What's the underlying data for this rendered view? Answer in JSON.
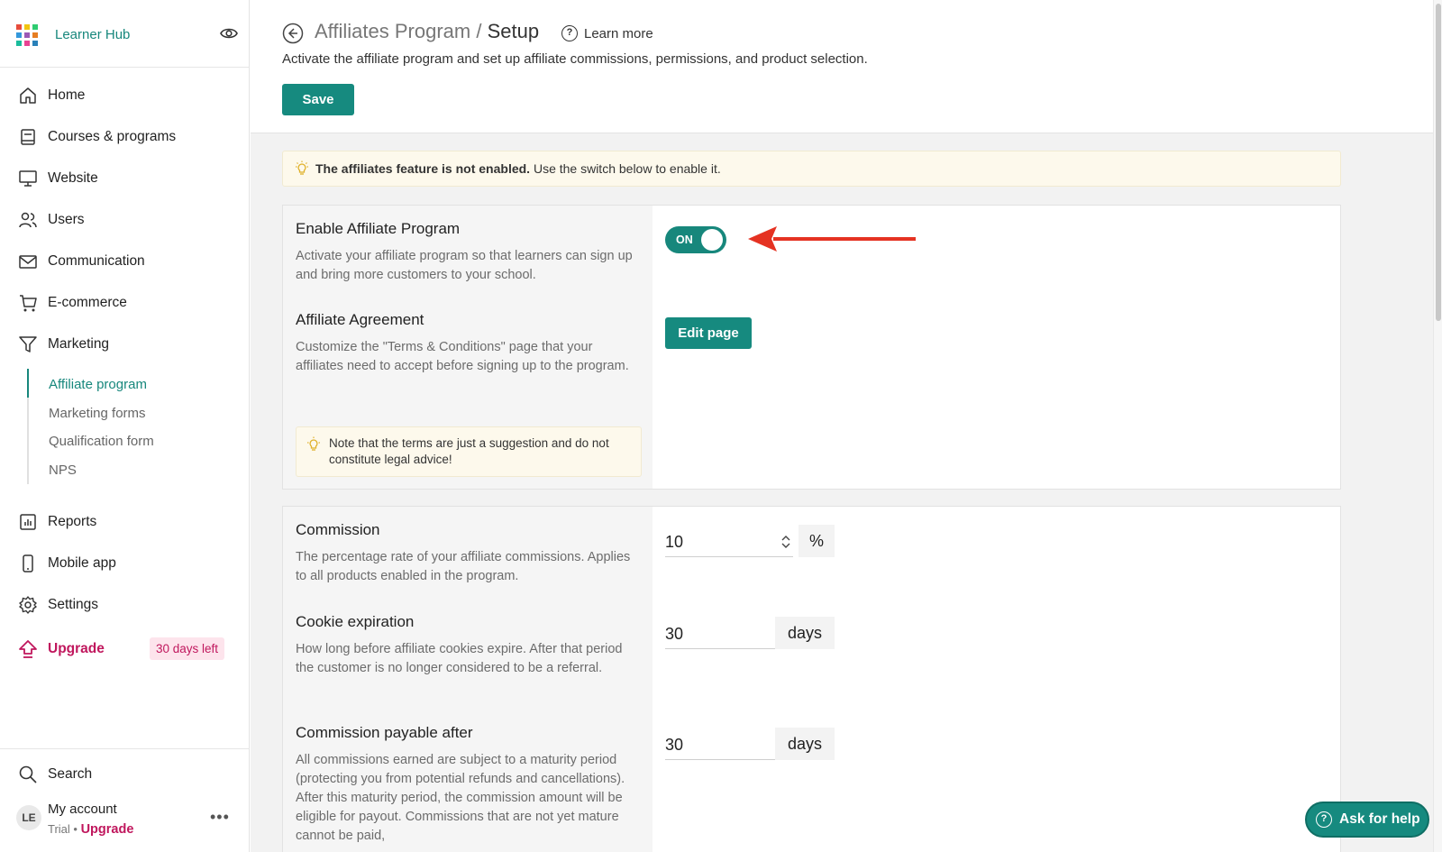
{
  "brand": {
    "name": "Learner Hub",
    "logo_colors": [
      "#e74c3c",
      "#f1c40f",
      "#2ecc71",
      "#3498db",
      "#9b59b6",
      "#e67e22",
      "#1abc9c",
      "#e84393",
      "#2980b9"
    ]
  },
  "sidebar": {
    "items": [
      {
        "label": "Home",
        "icon": "home-icon"
      },
      {
        "label": "Courses & programs",
        "icon": "book-icon"
      },
      {
        "label": "Website",
        "icon": "monitor-icon"
      },
      {
        "label": "Users",
        "icon": "users-icon"
      },
      {
        "label": "Communication",
        "icon": "mail-icon"
      },
      {
        "label": "E-commerce",
        "icon": "cart-icon"
      },
      {
        "label": "Marketing",
        "icon": "funnel-icon"
      }
    ],
    "marketing_sub": [
      "Affiliate program",
      "Marketing forms",
      "Qualification form",
      "NPS"
    ],
    "items_after": [
      {
        "label": "Reports",
        "icon": "chart-icon"
      },
      {
        "label": "Mobile app",
        "icon": "phone-icon"
      },
      {
        "label": "Settings",
        "icon": "gear-icon"
      }
    ],
    "upgrade": {
      "label": "Upgrade",
      "badge": "30 days left"
    },
    "search_label": "Search",
    "account": {
      "initials": "LE",
      "name": "My account",
      "plan": "Trial",
      "separator": " • ",
      "upgrade": "Upgrade"
    }
  },
  "header": {
    "title_prefix": "Affiliates Program / ",
    "title_current": "Setup",
    "learn_more": "Learn more",
    "subtitle": "Activate the affiliate program and set up affiliate commissions, permissions, and product selection.",
    "save_label": "Save"
  },
  "alert": {
    "bold": "The affiliates feature is not enabled.",
    "rest": " Use the switch below to enable it."
  },
  "enable": {
    "title": "Enable Affiliate Program",
    "desc": "Activate your affiliate program so that learners can sign up and bring more customers to your school.",
    "toggle_label": "ON"
  },
  "agreement": {
    "title": "Affiliate Agreement",
    "desc": "Customize the \"Terms & Conditions\" page that your affiliates need to accept before signing up to the program.",
    "button": "Edit page",
    "note": "Note that the terms are just a suggestion and do not constitute legal advice!"
  },
  "commission": {
    "title": "Commission",
    "desc": "The percentage rate of your affiliate commissions. Applies to all products enabled in the program.",
    "value": "10",
    "unit": "%"
  },
  "cookie": {
    "title": "Cookie expiration",
    "desc": "How long before affiliate cookies expire. After that period the customer is no longer considered to be a referral.",
    "value": "30",
    "unit": "days"
  },
  "payable": {
    "title": "Commission payable after",
    "desc": "All commissions earned are subject to a maturity period (protecting you from potential refunds and cancellations). After this maturity period, the commission amount will be eligible for payout. Commissions that are not yet mature cannot be paid,",
    "value": "30",
    "unit": "days"
  },
  "help": {
    "label": "Ask for help"
  },
  "colors": {
    "accent": "#17877c",
    "upgrade": "#c0175d",
    "annotation_arrow": "#e53222"
  }
}
